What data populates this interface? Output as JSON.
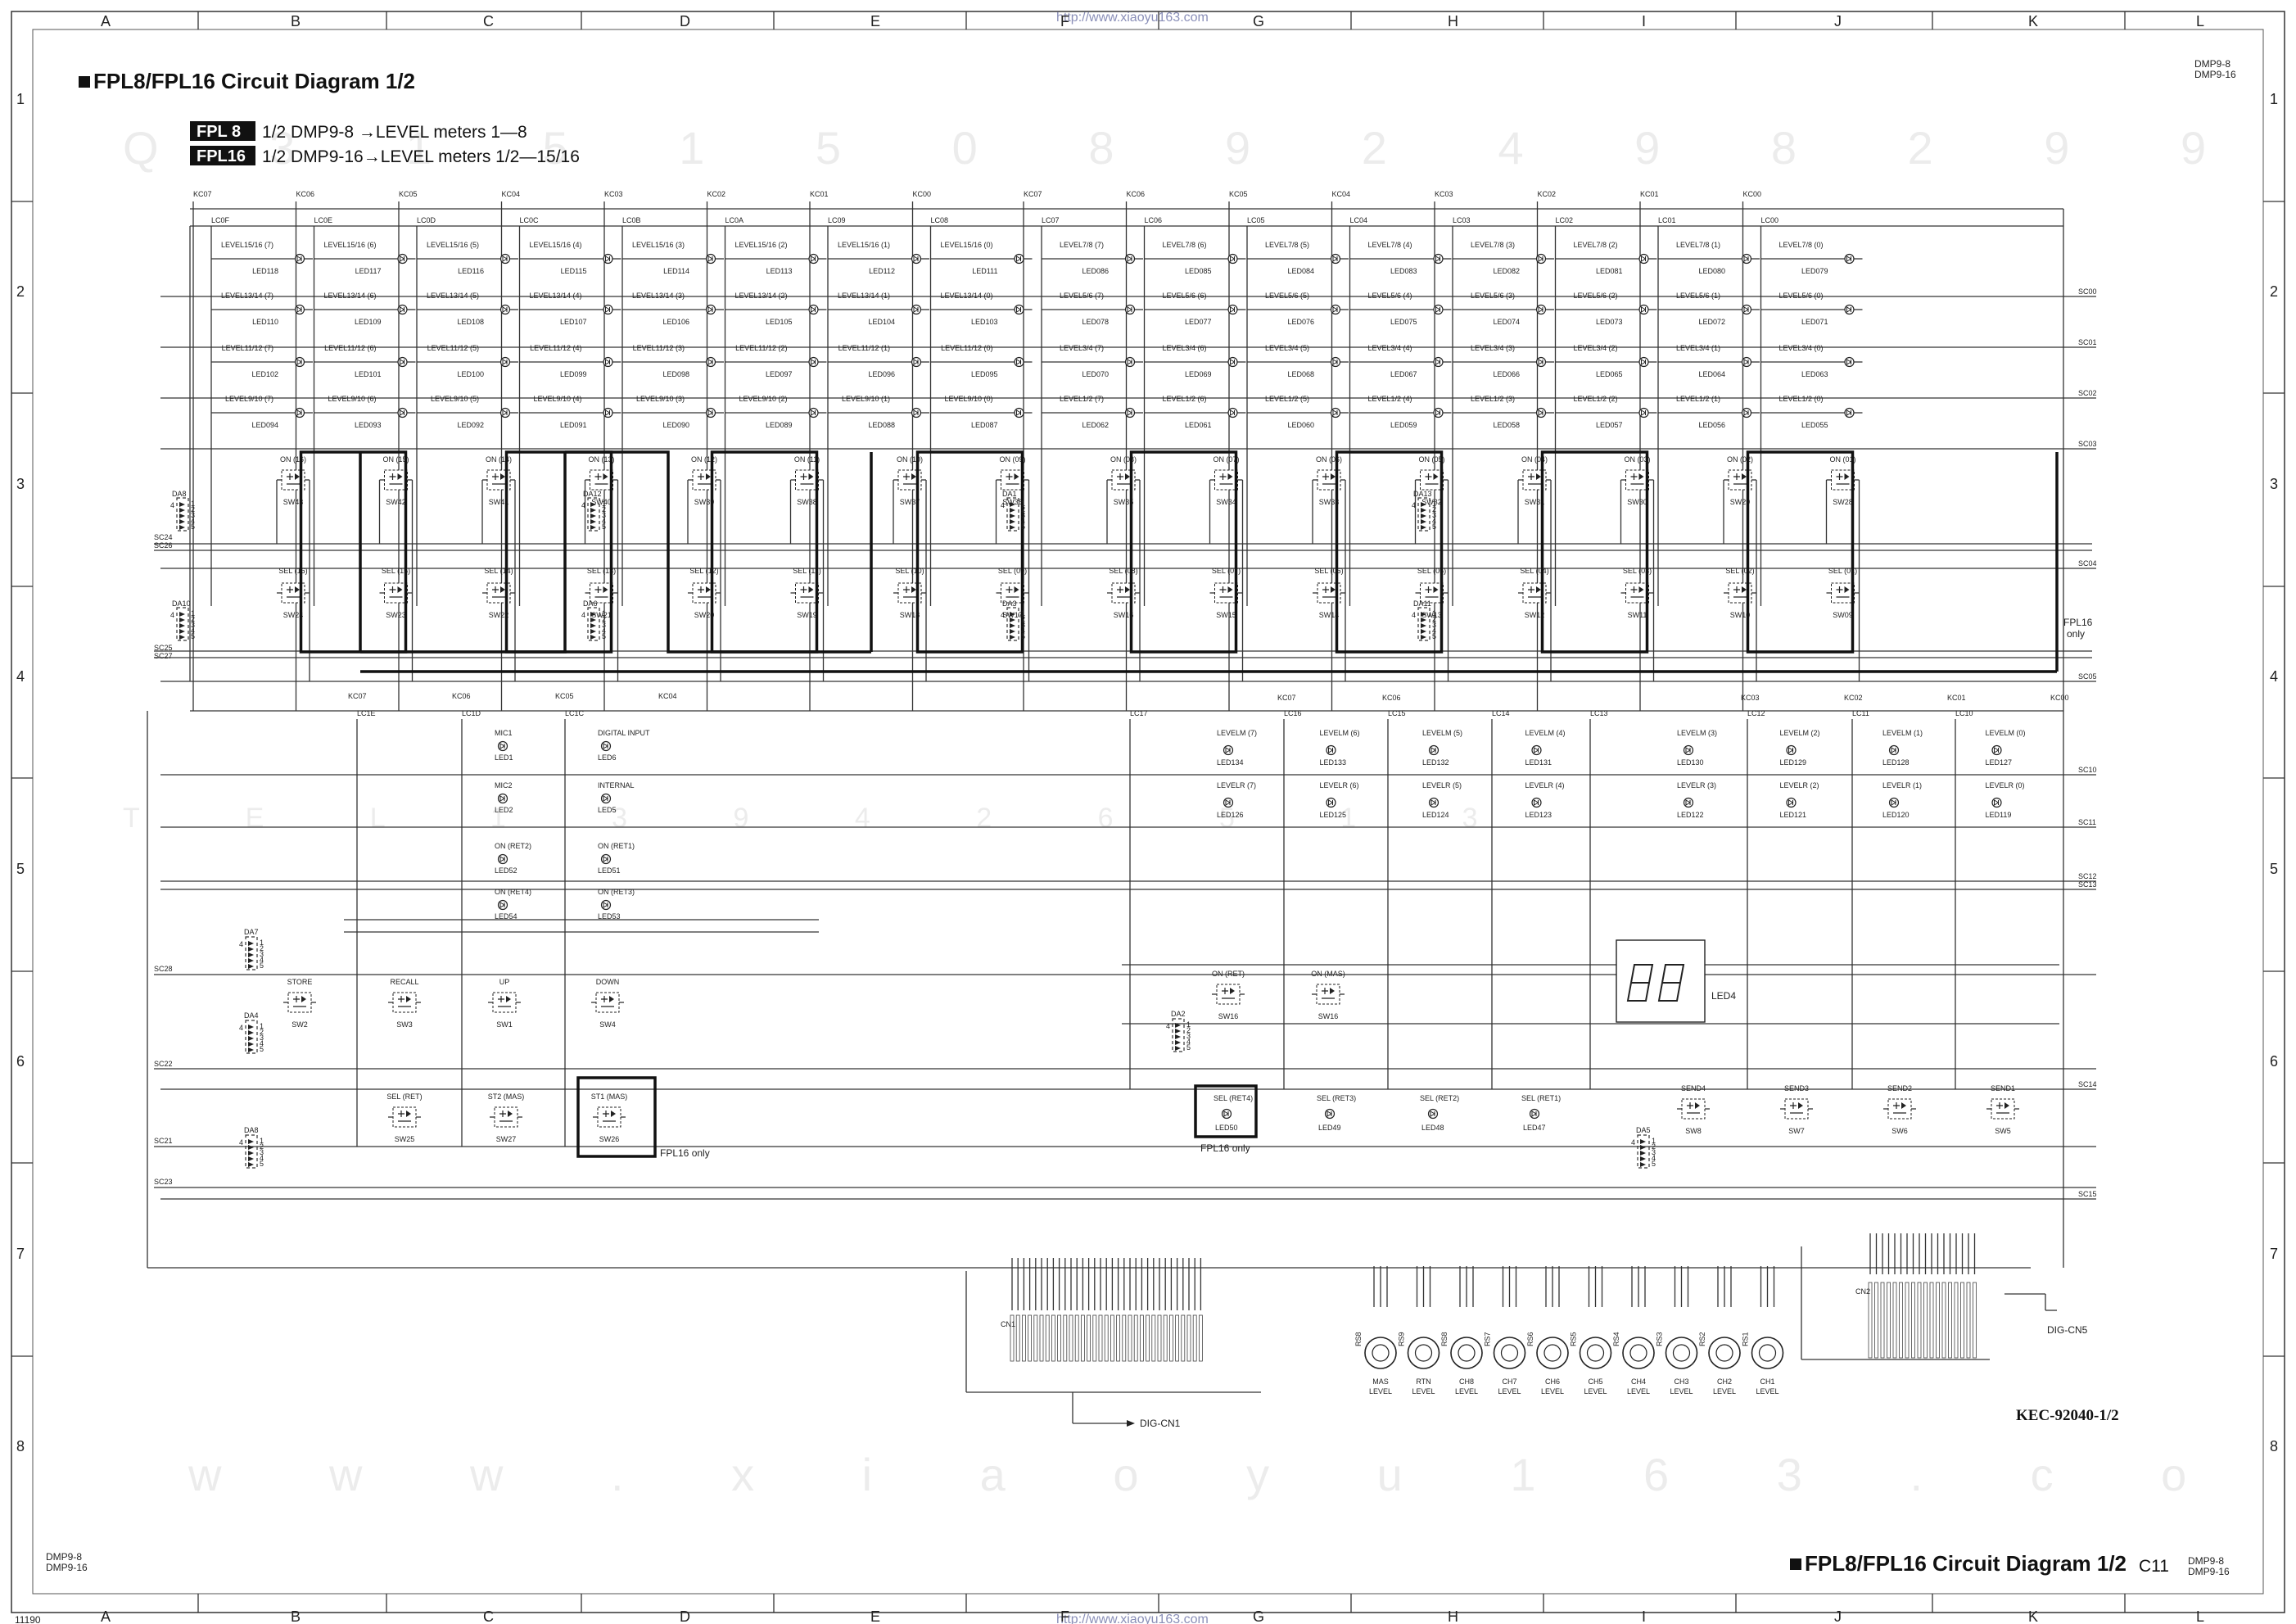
{
  "header": {
    "title": "FPL8/FPL16 Circuit Diagram 1/2",
    "model_top_right": [
      "DMP9-8",
      "DMP9-16"
    ],
    "model_bottom_left": [
      "DMP9-8",
      "DMP9-16"
    ],
    "model_bottom_right": [
      "DMP9-8",
      "DMP9-16"
    ],
    "page_code": "C11",
    "doc_code": "KEC-92040-1/2",
    "url": "http://www.xiaoyu163.com",
    "corner_mark": "11190"
  },
  "legend": [
    {
      "tag": "FPL 8",
      "text": "1/2   DMP9-8  →LEVEL meters 1—8"
    },
    {
      "tag": "FPL16",
      "text": "1/2   DMP9-16→LEVEL meters 1/2—15/16"
    }
  ],
  "watermark": {
    "row1": "Q 3 1 5 1 5 0   8 9 2 4 9 8 2 9 9",
    "row2": "T E L 1 3 9 4 2 6 5 1 3",
    "row3": "w w w . x i a o y u 1 6 3 . c o m"
  },
  "grid": {
    "cols": [
      "A",
      "B",
      "C",
      "D",
      "E",
      "F",
      "G",
      "H",
      "I",
      "J",
      "K",
      "L"
    ],
    "rows": [
      "1",
      "2",
      "3",
      "4",
      "5",
      "6",
      "7",
      "8"
    ]
  },
  "top": {
    "kc_top": [
      "KC07",
      "KC06",
      "KC05",
      "KC04",
      "KC03",
      "KC02",
      "KC01",
      "KC00",
      "KC07",
      "KC06",
      "KC05",
      "KC04",
      "KC03",
      "KC02",
      "KC01",
      "KC00"
    ],
    "columns": [
      {
        "lc": "LC0F",
        "levels": [
          "LEVEL15/16 (7)",
          "LEVEL13/14 (7)",
          "LEVEL11/12 (7)",
          "LEVEL9/10 (7)"
        ],
        "leds": [
          "LED118",
          "LED110",
          "LED102",
          "LED094"
        ],
        "on": "ON (16)",
        "on_sw": "SW43",
        "sel": "SEL (16)",
        "sel_sw": "SW24",
        "da_on": "DA8",
        "da_sel": "DA10"
      },
      {
        "lc": "LC0E",
        "levels": [
          "LEVEL15/16 (6)",
          "LEVEL13/14 (6)",
          "LEVEL11/12 (6)",
          "LEVEL9/10 (6)"
        ],
        "leds": [
          "LED117",
          "LED109",
          "LED101",
          "LED093"
        ],
        "on": "ON (15)",
        "on_sw": "SW42",
        "sel": "SEL (15)",
        "sel_sw": "SW23"
      },
      {
        "lc": "LC0D",
        "levels": [
          "LEVEL15/16 (5)",
          "LEVEL13/14 (5)",
          "LEVEL11/12 (5)",
          "LEVEL9/10 (5)"
        ],
        "leds": [
          "LED116",
          "LED108",
          "LED100",
          "LED092"
        ],
        "on": "ON (14)",
        "on_sw": "SW41",
        "sel": "SEL (14)",
        "sel_sw": "SW22"
      },
      {
        "lc": "LC0C",
        "levels": [
          "LEVEL15/16 (4)",
          "LEVEL13/14 (4)",
          "LEVEL11/12 (4)",
          "LEVEL9/10 (4)"
        ],
        "leds": [
          "LED115",
          "LED107",
          "LED099",
          "LED091"
        ],
        "on": "ON (13)",
        "on_sw": "SW40",
        "sel": "SEL (13)",
        "sel_sw": "SW21"
      },
      {
        "lc": "LC0B",
        "levels": [
          "LEVEL15/16 (3)",
          "LEVEL13/14 (3)",
          "LEVEL11/12 (3)",
          "LEVEL9/10 (3)"
        ],
        "leds": [
          "LED114",
          "LED106",
          "LED098",
          "LED090"
        ],
        "on": "ON (12)",
        "on_sw": "SW39",
        "sel": "SEL (12)",
        "sel_sw": "SW20",
        "da_on": "DA12",
        "da_sel": "DA6"
      },
      {
        "lc": "LC0A",
        "levels": [
          "LEVEL15/16 (2)",
          "LEVEL13/14 (2)",
          "LEVEL11/12 (2)",
          "LEVEL9/10 (2)"
        ],
        "leds": [
          "LED113",
          "LED105",
          "LED097",
          "LED089"
        ],
        "on": "ON (11)",
        "on_sw": "SW38",
        "sel": "SEL (11)",
        "sel_sw": "SW19"
      },
      {
        "lc": "LC09",
        "levels": [
          "LEVEL15/16 (1)",
          "LEVEL13/14 (1)",
          "LEVEL11/12 (1)",
          "LEVEL9/10 (1)"
        ],
        "leds": [
          "LED112",
          "LED104",
          "LED096",
          "LED088"
        ],
        "on": "ON (10)",
        "on_sw": "SW37",
        "sel": "SEL (10)",
        "sel_sw": "SW18"
      },
      {
        "lc": "LC08",
        "levels": [
          "LEVEL15/16 (0)",
          "LEVEL13/14 (0)",
          "LEVEL11/12 (0)",
          "LEVEL9/10 (0)"
        ],
        "leds": [
          "LED111",
          "LED103",
          "LED095",
          "LED087"
        ],
        "on": "ON (09)",
        "on_sw": "SW36",
        "sel": "SEL (09)",
        "sel_sw": "SW17"
      },
      {
        "lc": "LC07",
        "levels": [
          "LEVEL7/8 (7)",
          "LEVEL5/6 (7)",
          "LEVEL3/4 (7)",
          "LEVEL1/2 (7)"
        ],
        "leds": [
          "LED086",
          "LED078",
          "LED070",
          "LED062"
        ],
        "on": "ON (08)",
        "on_sw": "SW35",
        "sel": "SEL (08)",
        "sel_sw": "SW16",
        "da_on": "DA1",
        "da_sel": "DA3"
      },
      {
        "lc": "LC06",
        "levels": [
          "LEVEL7/8 (6)",
          "LEVEL5/6 (6)",
          "LEVEL3/4 (6)",
          "LEVEL1/2 (6)"
        ],
        "leds": [
          "LED085",
          "LED077",
          "LED069",
          "LED061"
        ],
        "on": "ON (07)",
        "on_sw": "SW34",
        "sel": "SEL (07)",
        "sel_sw": "SW15"
      },
      {
        "lc": "LC05",
        "levels": [
          "LEVEL7/8 (5)",
          "LEVEL5/6 (5)",
          "LEVEL3/4 (5)",
          "LEVEL1/2 (5)"
        ],
        "leds": [
          "LED084",
          "LED076",
          "LED068",
          "LED060"
        ],
        "on": "ON (06)",
        "on_sw": "SW33",
        "sel": "SEL (06)",
        "sel_sw": "SW14"
      },
      {
        "lc": "LC04",
        "levels": [
          "LEVEL7/8 (4)",
          "LEVEL5/6 (4)",
          "LEVEL3/4 (4)",
          "LEVEL1/2 (4)"
        ],
        "leds": [
          "LED083",
          "LED075",
          "LED067",
          "LED059"
        ],
        "on": "ON (05)",
        "on_sw": "SW32",
        "sel": "SEL (05)",
        "sel_sw": "SW13"
      },
      {
        "lc": "LC03",
        "levels": [
          "LEVEL7/8 (3)",
          "LEVEL5/6 (3)",
          "LEVEL3/4 (3)",
          "LEVEL1/2 (3)"
        ],
        "leds": [
          "LED082",
          "LED074",
          "LED066",
          "LED058"
        ],
        "on": "ON (04)",
        "on_sw": "SW31",
        "sel": "SEL (04)",
        "sel_sw": "SW12",
        "da_on": "DA13",
        "da_sel": "DA11"
      },
      {
        "lc": "LC02",
        "levels": [
          "LEVEL7/8 (2)",
          "LEVEL5/6 (2)",
          "LEVEL3/4 (2)",
          "LEVEL1/2 (2)"
        ],
        "leds": [
          "LED081",
          "LED073",
          "LED065",
          "LED057"
        ],
        "on": "ON (03)",
        "on_sw": "SW30",
        "sel": "SEL (03)",
        "sel_sw": "SW11"
      },
      {
        "lc": "LC01",
        "levels": [
          "LEVEL7/8 (1)",
          "LEVEL5/6 (1)",
          "LEVEL3/4 (1)",
          "LEVEL1/2 (1)"
        ],
        "leds": [
          "LED080",
          "LED072",
          "LED064",
          "LED056"
        ],
        "on": "ON (02)",
        "on_sw": "SW29",
        "sel": "SEL (02)",
        "sel_sw": "SW10"
      },
      {
        "lc": "LC00",
        "levels": [
          "LEVEL7/8 (0)",
          "LEVEL5/6 (0)",
          "LEVEL3/4 (0)",
          "LEVEL1/2 (0)"
        ],
        "leds": [
          "LED079",
          "LED071",
          "LED063",
          "LED055"
        ],
        "on": "ON (01)",
        "on_sw": "SW28",
        "sel": "SEL (01)",
        "sel_sw": "SW09"
      }
    ],
    "sc_right": [
      "SC00",
      "SC01",
      "SC02",
      "SC03",
      "SC04",
      "SC05"
    ],
    "sc_left": [
      "SC24",
      "SC26",
      "SC25",
      "SC27"
    ],
    "fpl16_note": [
      "FPL16",
      "only"
    ]
  },
  "bottom": {
    "kc_left": [
      "KC07",
      "KC06",
      "KC05",
      "KC04"
    ],
    "kc_right": [
      "KC07",
      "KC06",
      "KC03",
      "KC02",
      "KC01",
      "KC00"
    ],
    "lc_left": [
      "LC1E",
      "LC1D",
      "LC1C"
    ],
    "lc_right": [
      "LC17",
      "LC16",
      "LC15",
      "LC14",
      "LC13",
      "LC12",
      "LC11",
      "LC10"
    ],
    "left_leds": [
      {
        "label": "MIC1",
        "ref": "LED1"
      },
      {
        "label": "DIGITAL INPUT",
        "ref": "LED6"
      },
      {
        "label": "MIC2",
        "ref": "LED2"
      },
      {
        "label": "INTERNAL",
        "ref": "LED5"
      },
      {
        "label": "ON (RET2)",
        "ref": "LED52"
      },
      {
        "label": "ON (RET1)",
        "ref": "LED51"
      },
      {
        "label": "ON (RET4)",
        "ref": "LED54"
      },
      {
        "label": "ON (RET3)",
        "ref": "LED53"
      }
    ],
    "meter_leds": [
      {
        "top": "LEVELM (7)",
        "top_ref": "LED134",
        "bot": "LEVELR (7)",
        "bot_ref": "LED126"
      },
      {
        "top": "LEVELM (6)",
        "top_ref": "LED133",
        "bot": "LEVELR (6)",
        "bot_ref": "LED125"
      },
      {
        "top": "LEVELM (5)",
        "top_ref": "LED132",
        "bot": "LEVELR (5)",
        "bot_ref": "LED124"
      },
      {
        "top": "LEVELM (4)",
        "top_ref": "LED131",
        "bot": "LEVELR (4)",
        "bot_ref": "LED123"
      },
      {
        "top": "LEVELM (3)",
        "top_ref": "LED130",
        "bot": "LEVELR (3)",
        "bot_ref": "LED122"
      },
      {
        "top": "LEVELM (2)",
        "top_ref": "LED129",
        "bot": "LEVELR (2)",
        "bot_ref": "LED121"
      },
      {
        "top": "LEVELM (1)",
        "top_ref": "LED128",
        "bot": "LEVELR (1)",
        "bot_ref": "LED120"
      },
      {
        "top": "LEVELM (0)",
        "top_ref": "LED127",
        "bot": "LEVELR (0)",
        "bot_ref": "LED119"
      }
    ],
    "switches": [
      {
        "label": "STORE",
        "sw": "SW2"
      },
      {
        "label": "RECALL",
        "sw": "SW3"
      },
      {
        "label": "UP",
        "sw": "SW1"
      },
      {
        "label": "DOWN",
        "sw": "SW4"
      },
      {
        "label": "SEL (RET)",
        "sw": "SW25"
      },
      {
        "label": "ST2 (MAS)",
        "sw": "SW27"
      },
      {
        "label": "ST1 (MAS)",
        "sw": "SW26"
      },
      {
        "label": "ON (RET)",
        "sw": "SW16"
      },
      {
        "label": "ON (MAS)",
        "sw": "SW16"
      },
      {
        "label": "SEND4",
        "sw": "SW8"
      },
      {
        "label": "SEND3",
        "sw": "SW7"
      },
      {
        "label": "SEND2",
        "sw": "SW6"
      },
      {
        "label": "SEND1",
        "sw": "SW5"
      }
    ],
    "sel_leds": [
      {
        "label": "SEL (RET4)",
        "ref": "LED50"
      },
      {
        "label": "SEL (RET3)",
        "ref": "LED49"
      },
      {
        "label": "SEL (RET2)",
        "ref": "LED48"
      },
      {
        "label": "SEL (RET1)",
        "ref": "LED47"
      }
    ],
    "da_labels": [
      "DA7",
      "DA4",
      "DA8",
      "DA2",
      "DA5"
    ],
    "sc_left": [
      "SC28",
      "SC22",
      "SC21",
      "SC23"
    ],
    "sc_right": [
      "SC10",
      "SC11",
      "SC12",
      "SC13",
      "SC14",
      "SC15"
    ],
    "display": "LED4",
    "fpl16_notes": [
      "FPL16 only",
      "FPL16 only"
    ]
  },
  "connectors": {
    "cn1": {
      "label": "CN1",
      "dest": "DIG-CN1"
    },
    "cn2": {
      "label": "CN2",
      "dest": "DIG-CN5"
    }
  },
  "knobs": [
    {
      "ref": "RS8",
      "label": [
        "MAS",
        "LEVEL"
      ]
    },
    {
      "ref": "RS9",
      "label": [
        "RTN",
        "LEVEL"
      ]
    },
    {
      "ref": "RS8",
      "label": [
        "CH8",
        "LEVEL"
      ]
    },
    {
      "ref": "RS7",
      "label": [
        "CH7",
        "LEVEL"
      ]
    },
    {
      "ref": "RS6",
      "label": [
        "CH6",
        "LEVEL"
      ]
    },
    {
      "ref": "RS5",
      "label": [
        "CH5",
        "LEVEL"
      ]
    },
    {
      "ref": "RS4",
      "label": [
        "CH4",
        "LEVEL"
      ]
    },
    {
      "ref": "RS3",
      "label": [
        "CH3",
        "LEVEL"
      ]
    },
    {
      "ref": "RS2",
      "label": [
        "CH2",
        "LEVEL"
      ]
    },
    {
      "ref": "RS1",
      "label": [
        "CH1",
        "LEVEL"
      ]
    }
  ]
}
